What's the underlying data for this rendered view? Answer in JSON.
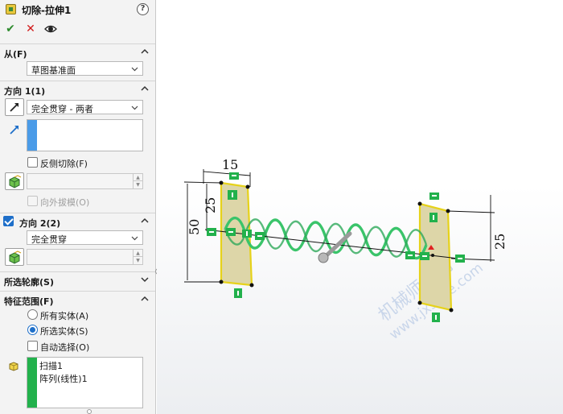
{
  "property_manager": {
    "title": "切除-拉伸1",
    "help": "?",
    "actions": {
      "ok": "✔",
      "cancel": "✕"
    },
    "from": {
      "label": "从(F)",
      "value": "草图基准面"
    },
    "direction1": {
      "label": "方向 1(1)",
      "end_condition": "完全贯穿 - 两者",
      "flip_side_cut": "反侧切除(F)",
      "draft_outward": "向外拔模(O)"
    },
    "direction2": {
      "label": "方向 2(2)",
      "end_condition": "完全贯穿"
    },
    "selected_contours": {
      "label": "所选轮廓(S)"
    },
    "feature_scope": {
      "label": "特征范围(F)",
      "option_all_bodies": "所有实体(A)",
      "option_selected_bodies": "所选实体(S)",
      "auto_select": "自动选择(O)",
      "bodies": [
        "扫描1",
        "阵列(线性)1"
      ]
    },
    "colors": {
      "selection_blue": "#4a9be8",
      "selection_green": "#22b14c",
      "ok_green": "#2e8b2e",
      "cancel_red": "#d11a1a"
    }
  },
  "viewport": {
    "dimensions": {
      "width_left": "15",
      "height_left_inner": "25",
      "height_left_outer": "50",
      "height_right": "25"
    },
    "watermark": {
      "line1": "机械师代网",
      "line2": "www.jxsoye.com"
    },
    "colors": {
      "spring_green": "#3ac46a",
      "sketch_fill": "#ddd6a8",
      "sketch_outline": "#e6d21a",
      "relation_green": "#22b14c"
    }
  }
}
